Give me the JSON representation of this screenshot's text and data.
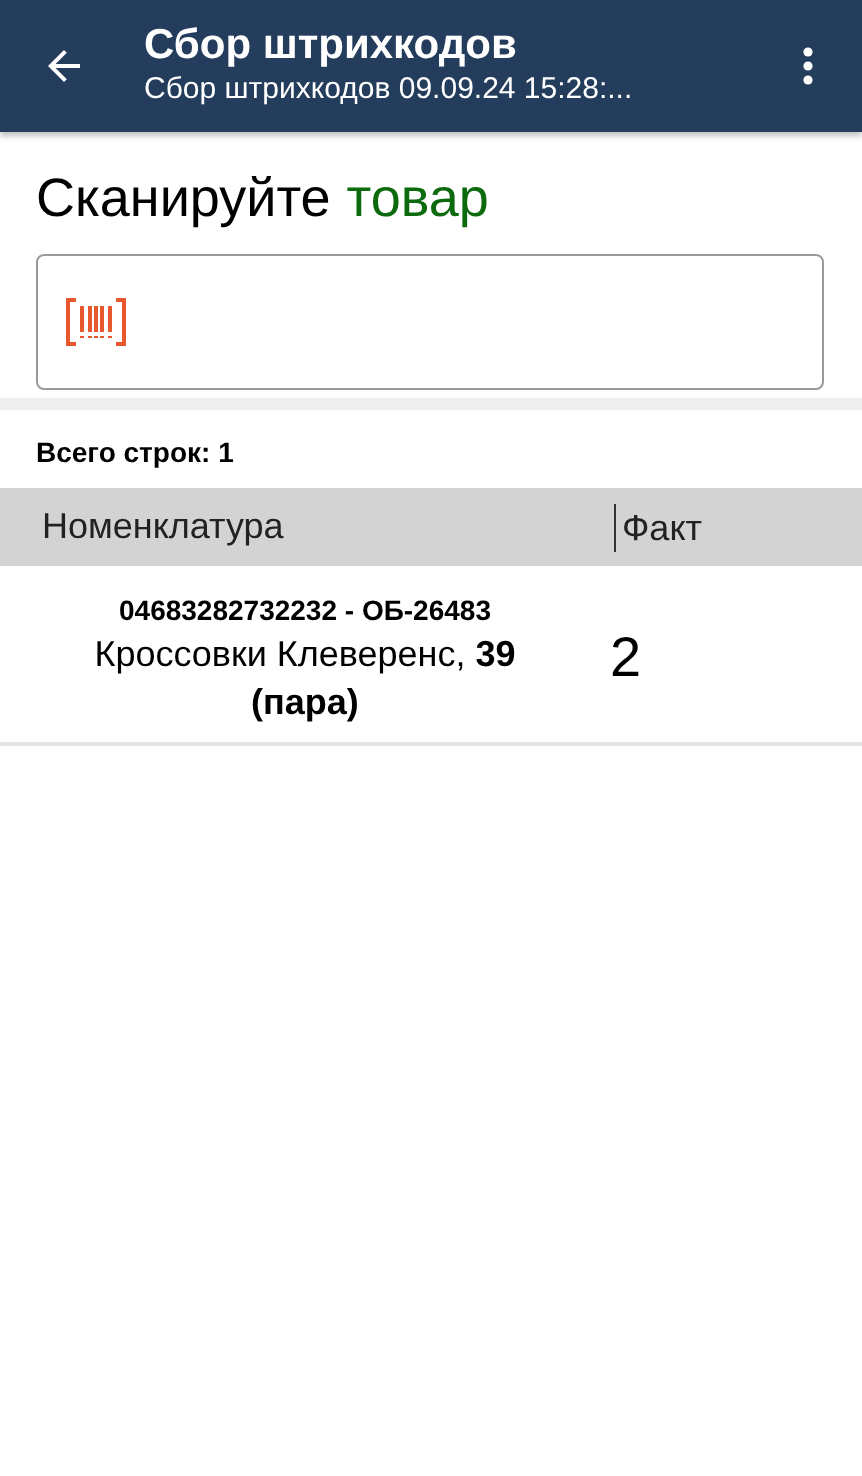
{
  "app_bar": {
    "title": "Сбор штрихкодов",
    "subtitle": "Сбор штрихкодов 09.09.24 15:28:..."
  },
  "prompt": {
    "text": "Сканируйте",
    "highlight": "товар"
  },
  "summary": "Всего строк: 1",
  "table": {
    "columns": [
      "Номенклатура",
      "Факт"
    ],
    "rows": [
      {
        "code": "04683282732232 - ОБ-26483",
        "name": "Кроссовки Клеверенс, **39 (пара)**",
        "fact": "2"
      }
    ]
  }
}
